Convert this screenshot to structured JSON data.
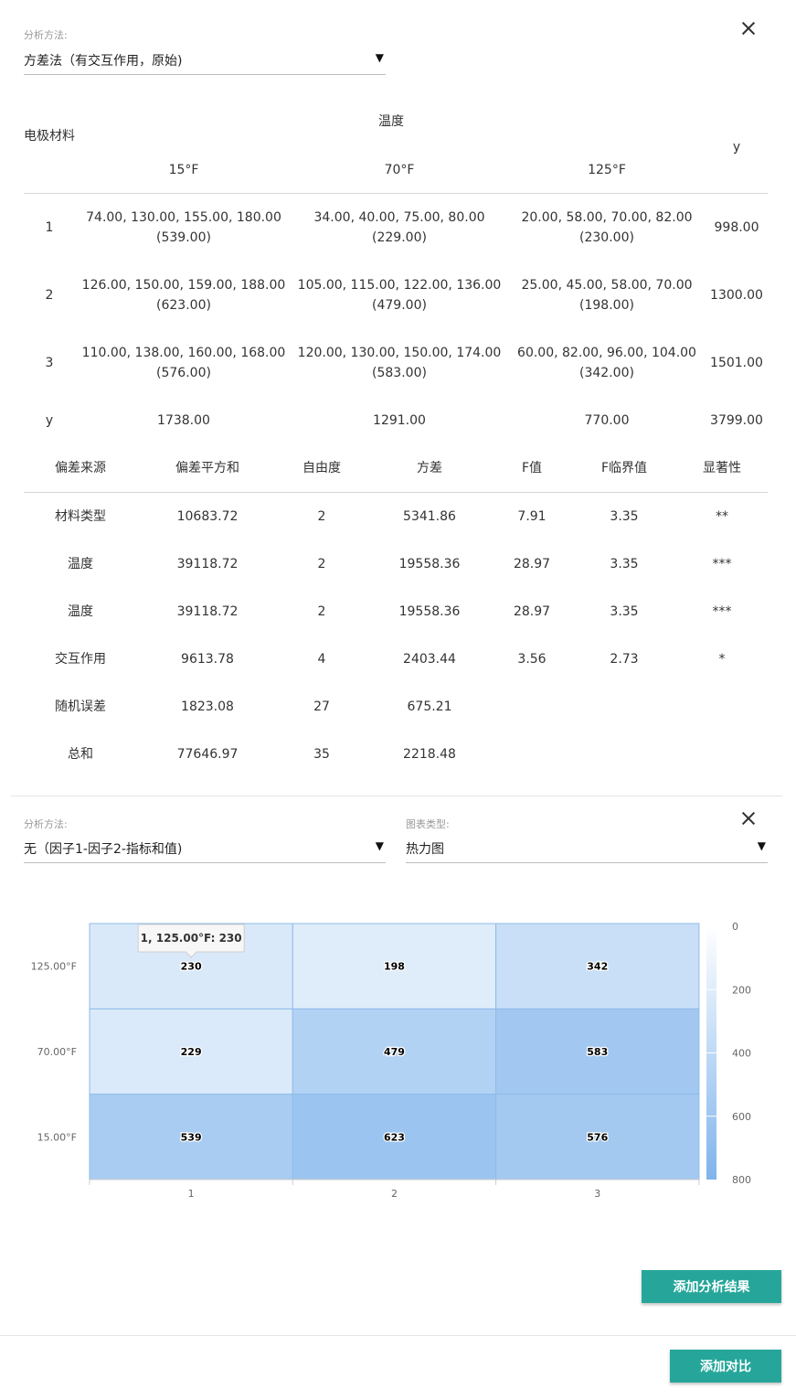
{
  "top": {
    "method_label": "分析方法:",
    "method_value": "方差法（有交互作用，原始)"
  },
  "anova_table": {
    "row_header": "电极材料",
    "col_group": "温度",
    "col_levels": [
      "15°F",
      "70°F",
      "125°F"
    ],
    "total_col": "y",
    "rows": [
      {
        "label": "1",
        "cells": [
          [
            "74.00, 130.00, 155.00, 180.00",
            "(539.00)"
          ],
          [
            "34.00, 40.00, 75.00, 80.00",
            "(229.00)"
          ],
          [
            "20.00, 58.00, 70.00, 82.00",
            "(230.00)"
          ]
        ],
        "total": "998.00"
      },
      {
        "label": "2",
        "cells": [
          [
            "126.00, 150.00, 159.00, 188.00",
            "(623.00)"
          ],
          [
            "105.00, 115.00, 122.00, 136.00",
            "(479.00)"
          ],
          [
            "25.00, 45.00, 58.00, 70.00",
            "(198.00)"
          ]
        ],
        "total": "1300.00"
      },
      {
        "label": "3",
        "cells": [
          [
            "110.00, 138.00, 160.00, 168.00",
            "(576.00)"
          ],
          [
            "120.00, 130.00, 150.00, 174.00",
            "(583.00)"
          ],
          [
            "60.00, 82.00, 96.00, 104.00",
            "(342.00)"
          ]
        ],
        "total": "1501.00"
      }
    ],
    "total_row": {
      "label": "y",
      "values": [
        "1738.00",
        "1291.00",
        "770.00"
      ],
      "grand": "3799.00"
    }
  },
  "variance_table": {
    "headers": [
      "偏差来源",
      "偏差平方和",
      "自由度",
      "方差",
      "F值",
      "F临界值",
      "显著性"
    ],
    "rows": [
      [
        "材料类型",
        "10683.72",
        "2",
        "5341.86",
        "7.91",
        "3.35",
        "**"
      ],
      [
        "温度",
        "39118.72",
        "2",
        "19558.36",
        "28.97",
        "3.35",
        "***"
      ],
      [
        "温度",
        "39118.72",
        "2",
        "19558.36",
        "28.97",
        "3.35",
        "***"
      ],
      [
        "交互作用",
        "9613.78",
        "4",
        "2403.44",
        "3.56",
        "2.73",
        "*"
      ],
      [
        "随机误差",
        "1823.08",
        "27",
        "675.21",
        "",
        "",
        ""
      ],
      [
        "总和",
        "77646.97",
        "35",
        "2218.48",
        "",
        "",
        ""
      ]
    ]
  },
  "chart_panel": {
    "method_label": "分析方法:",
    "method_value": "无（因子1-因子2-指标和值)",
    "type_label": "图表类型:",
    "type_value": "热力图"
  },
  "chart_data": {
    "type": "heatmap",
    "x": [
      "1",
      "2",
      "3"
    ],
    "y": [
      "15.00°F",
      "70.00°F",
      "125.00°F"
    ],
    "values": [
      [
        539,
        623,
        576
      ],
      [
        229,
        479,
        583
      ],
      [
        230,
        198,
        342
      ]
    ],
    "color_range": [
      0,
      800
    ],
    "legend_ticks": [
      "0",
      "200",
      "400",
      "600",
      "800"
    ],
    "color_min": "#ffffff",
    "color_max": "#7fb4ec",
    "tooltip": "1, 125.00°F: 230"
  },
  "buttons": {
    "add_result": "添加分析结果",
    "add_compare": "添加对比"
  }
}
